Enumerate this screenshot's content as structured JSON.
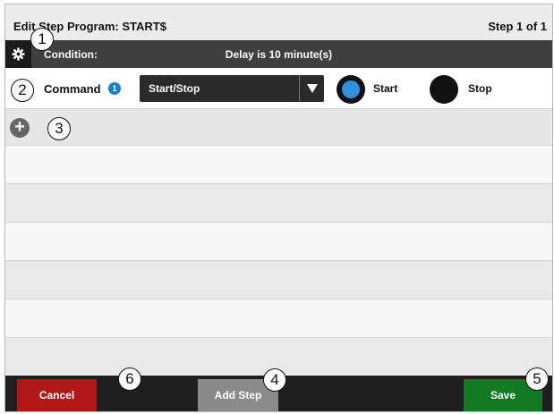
{
  "title_bar": {
    "title": "Edit Step Program:  START$",
    "step_indicator": "Step 1 of 1"
  },
  "condition": {
    "label": "Condition:",
    "value": "Delay is 10 minute(s)",
    "gear_icon": "gear-icon"
  },
  "command": {
    "label": "Command",
    "info_badge": "1",
    "select_value": "Start/Stop",
    "options": [
      {
        "label": "Start",
        "selected": true
      },
      {
        "label": "Stop",
        "selected": false
      }
    ]
  },
  "add_row": {
    "icon": "plus-icon"
  },
  "footer": {
    "cancel_label": "Cancel",
    "add_step_label": "Add Step",
    "save_label": "Save"
  },
  "callouts": [
    "1",
    "2",
    "3",
    "4",
    "5",
    "6"
  ],
  "colors": {
    "cancel": "#b21818",
    "save": "#127a22",
    "add_step": "#8a8a8a",
    "radio_on": "#2f8fe0",
    "condition_bar": "#3f3f3f"
  }
}
